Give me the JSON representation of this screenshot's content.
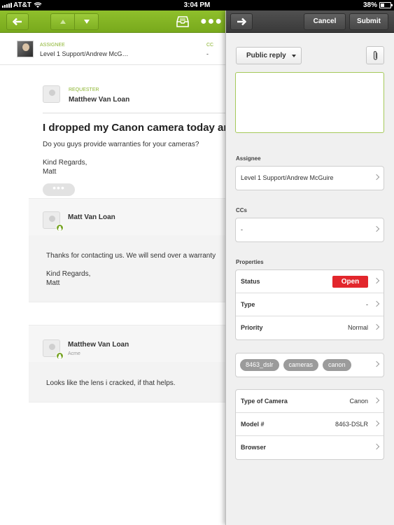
{
  "status_bar": {
    "carrier": "AT&T",
    "time": "3:04 PM",
    "battery": "38%"
  },
  "ticket_header": {
    "assignee_label": "ASSIGNEE",
    "assignee_value": "Level 1 Support/Andrew McG…",
    "cc_label": "CC",
    "cc_value": "-"
  },
  "conversation": {
    "requester_label": "REQUESTER",
    "requester_name": "Matthew Van Loan",
    "subject": "I dropped my Canon camera today an",
    "question": "Do you guys provide warranties for your cameras?",
    "signoff": "Kind Regards,",
    "signoff_name": "Matt",
    "more_glyph": "•••",
    "comments": [
      {
        "author": "Matt Van Loan",
        "org": "",
        "lines": [
          "Thanks for contacting us. We will send over a warranty",
          "",
          "Kind Regards,",
          "Matt"
        ]
      },
      {
        "author": "Matthew Van Loan",
        "org": "Acme",
        "lines": [
          "Looks like the lens i cracked, if that helps."
        ]
      }
    ]
  },
  "right_panel": {
    "cancel_label": "Cancel",
    "submit_label": "Submit",
    "reply_type": "Public reply",
    "reply_placeholder": "",
    "assignee_section": "Assignee",
    "assignee_value": "Level 1 Support/Andrew McGuire",
    "ccs_section": "CCs",
    "ccs_value": "-",
    "properties_section": "Properties",
    "status_label": "Status",
    "status_value": "Open",
    "type_label": "Type",
    "type_value": "-",
    "priority_label": "Priority",
    "priority_value": "Normal",
    "tags": [
      "8463_dslr",
      "cameras",
      "canon"
    ],
    "custom_fields": [
      {
        "label": "Type of Camera",
        "value": "Canon"
      },
      {
        "label": "Model #",
        "value": "8463-DSLR"
      },
      {
        "label": "Browser",
        "value": ""
      }
    ]
  },
  "colors": {
    "toolbar_green": "#8fbf2c",
    "accent_green": "#8cb531",
    "status_open_red": "#e2262c",
    "panel_dark": "#444444"
  },
  "icons": [
    "back-arrow-icon",
    "up-arrow-icon",
    "down-arrow-icon",
    "inbox-icon",
    "more-icon",
    "forward-arrow-icon",
    "paperclip-icon",
    "chevron-right-icon"
  ]
}
